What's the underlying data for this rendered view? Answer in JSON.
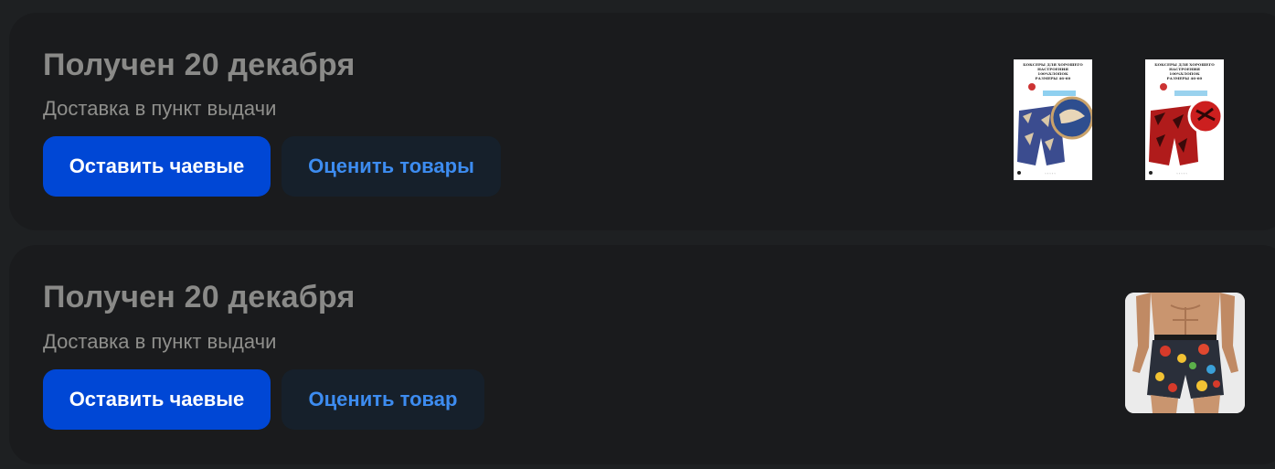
{
  "orders": [
    {
      "title": "Получен 20 декабря",
      "subtitle": "Доставка в пункт выдачи",
      "tip_button": "Оставить чаевые",
      "rate_button": "Оценить товары",
      "products": [
        {
          "name": "boxers-blue-print",
          "image_text_lines": [
            "БОКСЕРЫ ДЛЯ ХОРОШЕГО",
            "НАСТРОЕНИЯ",
            "100%ХЛОПОК",
            "РАЗМЕРЫ 46-60"
          ]
        },
        {
          "name": "boxers-red-print",
          "image_text_lines": [
            "БОКСЕРЫ ДЛЯ ХОРОШЕГО",
            "НАСТРОЕНИЯ",
            "100%ХЛОПОК",
            "РАЗМЕРЫ 46-60"
          ]
        }
      ]
    },
    {
      "title": "Получен 20 декабря",
      "subtitle": "Доставка в пункт выдачи",
      "tip_button": "Оставить чаевые",
      "rate_button": "Оценить товар",
      "products": [
        {
          "name": "boxers-floral-model"
        }
      ]
    }
  ],
  "colors": {
    "page_bg": "#1e2022",
    "card_bg": "#1a1b1d",
    "title": "#8a8a88",
    "primary_button": "#0047d5",
    "secondary_button_bg": "#16202b",
    "secondary_button_text": "#3d8cf0"
  }
}
